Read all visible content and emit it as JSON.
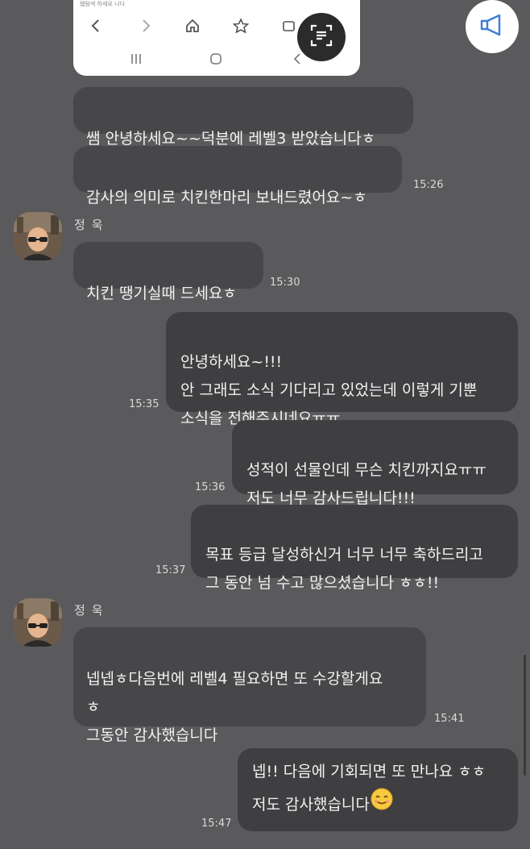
{
  "browser": {
    "snippet_text": "웹탐색 하세요 니다",
    "toolbar_icons": [
      "back-icon",
      "forward-icon",
      "home-icon",
      "bookmark-icon",
      "tabs-icon"
    ],
    "nav_icons": [
      "recent-apps-icon",
      "home-circle-icon",
      "back-nav-icon"
    ]
  },
  "overlay": {
    "scan_icon": "text-scan-icon",
    "announce_icon": "megaphone-icon"
  },
  "messages": [
    {
      "id": "m1",
      "direction": "in",
      "text": "쌤 안녕하세요~~덕분에 레벨3 받았습니다ㅎ"
    },
    {
      "id": "m2",
      "direction": "in",
      "text": "감사의 의미로 치킨한마리 보내드렸어요~ㅎ",
      "time": "15:26"
    },
    {
      "id": "m3",
      "direction": "in",
      "sender": "정욱",
      "text": "치킨 땡기실때 드세요ㅎ",
      "time": "15:30"
    },
    {
      "id": "m4",
      "direction": "out",
      "text": "안녕하세요~!!!\n안 그래도 소식 기다리고 있었는데 이렇게 기뿐\n소식을 전해주시네요ㅠㅠ",
      "time": "15:35"
    },
    {
      "id": "m5",
      "direction": "out",
      "text": "성적이 선물인데 무슨 치킨까지요ㅠㅠ\n저도 너무 감사드립니다!!!",
      "time": "15:36"
    },
    {
      "id": "m6",
      "direction": "out",
      "text": "목표 등급 달성하신거 너무 너무 축하드리고\n그 동안 넘 수고 많으셨습니다 ㅎㅎ!!",
      "time": "15:37"
    },
    {
      "id": "m7",
      "direction": "in",
      "sender": "정욱",
      "text": "넵넵ㅎ다음번에 레벨4 필요하면 또 수강할게요\nㅎ\n그동안 감사했습니다",
      "time": "15:41"
    },
    {
      "id": "m8",
      "direction": "out",
      "text_line1": "넵!! 다음에 기회되면 또 만나요 ㅎㅎ",
      "text_line2": "저도 감사했습니다",
      "emoji": "smiling-face-emoji",
      "time": "15:47"
    }
  ]
}
